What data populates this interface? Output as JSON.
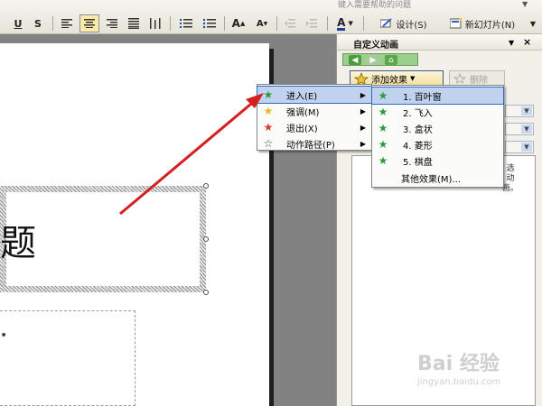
{
  "help": {
    "placeholder": "键入需要帮助的问题"
  },
  "toolbar": {
    "underline": "U",
    "shadow": "S",
    "grow_font": "A",
    "shrink_font": "A",
    "font_color": "A",
    "design_label": "设计(S)",
    "new_slide_label": "新幻灯片(N)"
  },
  "slide": {
    "title_partial": "题",
    "body_partial": "•"
  },
  "task_pane": {
    "title": "自定义动画",
    "add_effect_label": "添加效果",
    "delete_label": "删除",
    "list_hint_partial": "选\n动\n画。"
  },
  "effect_menu": {
    "items": [
      {
        "label": "进入(E)",
        "icon": "green-star-icon",
        "highlighted": true
      },
      {
        "label": "强调(M)",
        "icon": "yellow-star-icon",
        "highlighted": false
      },
      {
        "label": "退出(X)",
        "icon": "red-star-icon",
        "highlighted": false
      },
      {
        "label": "动作路径(P)",
        "icon": "outline-star-icon",
        "highlighted": false
      }
    ]
  },
  "entrance_menu": {
    "items": [
      {
        "label": "1. 百叶窗",
        "icon": "blinds-star-icon",
        "highlighted": true
      },
      {
        "label": "2. 飞入",
        "icon": "fly-in-star-icon",
        "highlighted": false
      },
      {
        "label": "3. 盒状",
        "icon": "box-star-icon",
        "highlighted": false
      },
      {
        "label": "4. 菱形",
        "icon": "diamond-star-icon",
        "highlighted": false
      },
      {
        "label": "5. 棋盘",
        "icon": "checkerboard-star-icon",
        "highlighted": false
      },
      {
        "label": "其他效果(M)...",
        "icon": "",
        "highlighted": false
      }
    ]
  },
  "watermark": {
    "brand": "Bai 经验",
    "url": "jingyan.baidu.com"
  },
  "colors": {
    "annotation_arrow": "#d42020",
    "highlight": "#c1d2ee",
    "green_star": "#2e9a3c",
    "yellow_star": "#e8b820",
    "red_star": "#d43a2a"
  }
}
